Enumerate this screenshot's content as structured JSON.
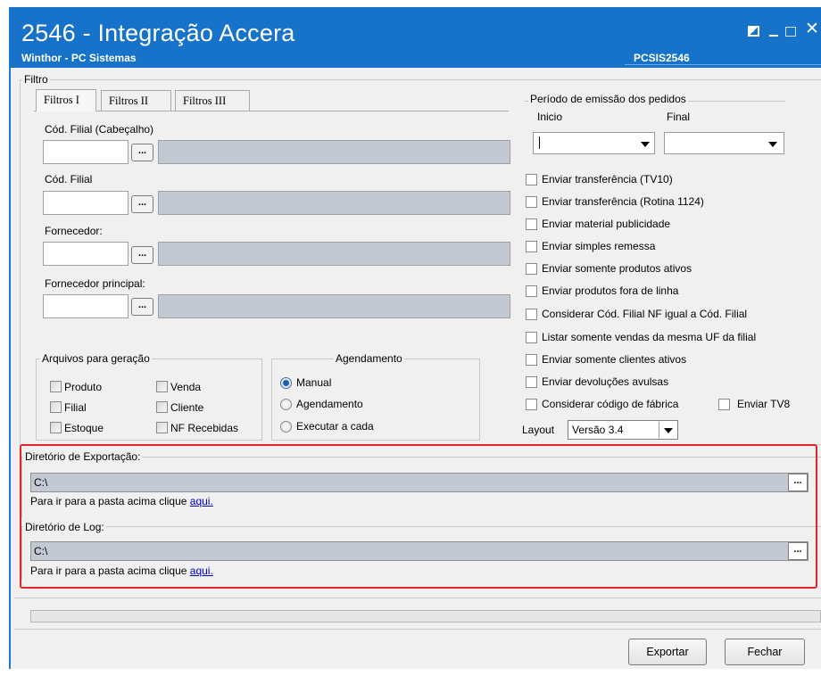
{
  "window": {
    "title": "2546 - Integração Accera",
    "subtitle": "Winthor - PC Sistemas",
    "code": "PCSIS2546",
    "titlebar_color": "#1773c9"
  },
  "filter_group": {
    "legend": "Filtro",
    "tabs": [
      {
        "label": "Filtros I",
        "active": true
      },
      {
        "label": "Filtros II",
        "active": false
      },
      {
        "label": "Filtros III",
        "active": false
      }
    ],
    "fields": [
      {
        "label": "Cód. Filial (Cabeçalho)",
        "value": ""
      },
      {
        "label": "Cód. Filial",
        "value": ""
      },
      {
        "label": "Fornecedor:",
        "value": ""
      },
      {
        "label": "Fornecedor principal:",
        "value": ""
      }
    ],
    "lookup_button": "..."
  },
  "files_group": {
    "legend": "Arquivos para geração",
    "checkboxes": [
      "Produto",
      "Venda",
      "Filial",
      "Cliente",
      "Estoque",
      "NF Recebidas"
    ]
  },
  "schedule_group": {
    "legend": "Agendamento",
    "options": [
      {
        "label": "Manual",
        "selected": true
      },
      {
        "label": "Agendamento",
        "selected": false
      },
      {
        "label": "Executar a cada",
        "selected": false
      }
    ]
  },
  "period_group": {
    "legend": "Período de emissão dos pedidos",
    "start_label": "Inicio",
    "end_label": "Final",
    "start_value": "",
    "end_value": ""
  },
  "options": [
    "Enviar transferência (TV10)",
    "Enviar transferência (Rotina 1124)",
    "Enviar material publicidade",
    "Enviar simples remessa",
    "Enviar somente produtos ativos",
    "Enviar produtos fora de linha",
    "Considerar Cód. Filial NF igual a Cód. Filial",
    "Listar somente vendas da mesma UF da filial",
    "Enviar somente clientes ativos",
    "Enviar devoluções avulsas",
    "Considerar código de fábrica"
  ],
  "option_tv8": "Enviar TV8",
  "layout": {
    "label": "Layout",
    "value": "Versão 3.4"
  },
  "export_dir": {
    "legend": "Diretório de Exportação:",
    "path": "C:\\",
    "hint": "Para ir para a pasta acima clique",
    "link": "aqui."
  },
  "log_dir": {
    "legend": "Diretório de Log:",
    "path": "C:\\",
    "hint": "Para ir para a pasta acima clique",
    "link": "aqui."
  },
  "browse_button": "...",
  "buttons": {
    "export": "Exportar",
    "close": "Fechar"
  },
  "highlight_color": "#e0262b"
}
